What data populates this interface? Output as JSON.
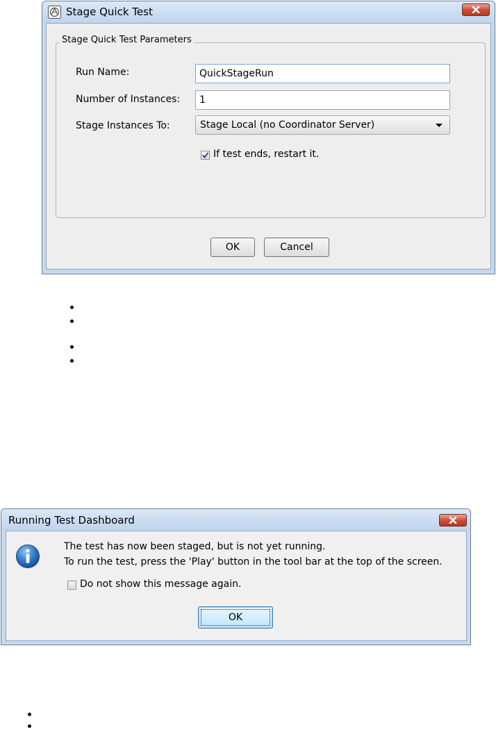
{
  "stage_dialog": {
    "title": "Stage Quick Test",
    "icon": "stage-quick-test-app-icon",
    "group_title": "Stage Quick Test Parameters",
    "run_name_label": "Run Name:",
    "run_name_value": "QuickStageRun",
    "instances_label": "Number of Instances:",
    "instances_value": "1",
    "stage_to_label": "Stage Instances To:",
    "stage_to_value": "Stage Local (no Coordinator Server)",
    "restart_checkbox_label": "If test ends, restart it.",
    "restart_checked": true,
    "ok_label": "OK",
    "cancel_label": "Cancel"
  },
  "bullet_groups": [
    {
      "count": 2
    },
    {
      "count": 2
    },
    {
      "count": 2
    }
  ],
  "dashboard_dialog": {
    "title": "Running Test Dashboard",
    "icon": "info-icon",
    "message_line1": "The test has now been staged, but is not yet running.",
    "message_line2": "To run the test, press the 'Play' button in the tool bar at the top of the screen.",
    "dont_show_label": "Do not show this message again.",
    "dont_show_checked": false,
    "ok_label": "OK"
  },
  "colors": {
    "window_frame": "#c8d9ee",
    "close_button": "#c94b36",
    "dialog_background": "#eeeeee",
    "default_button": "#bee6fd"
  }
}
